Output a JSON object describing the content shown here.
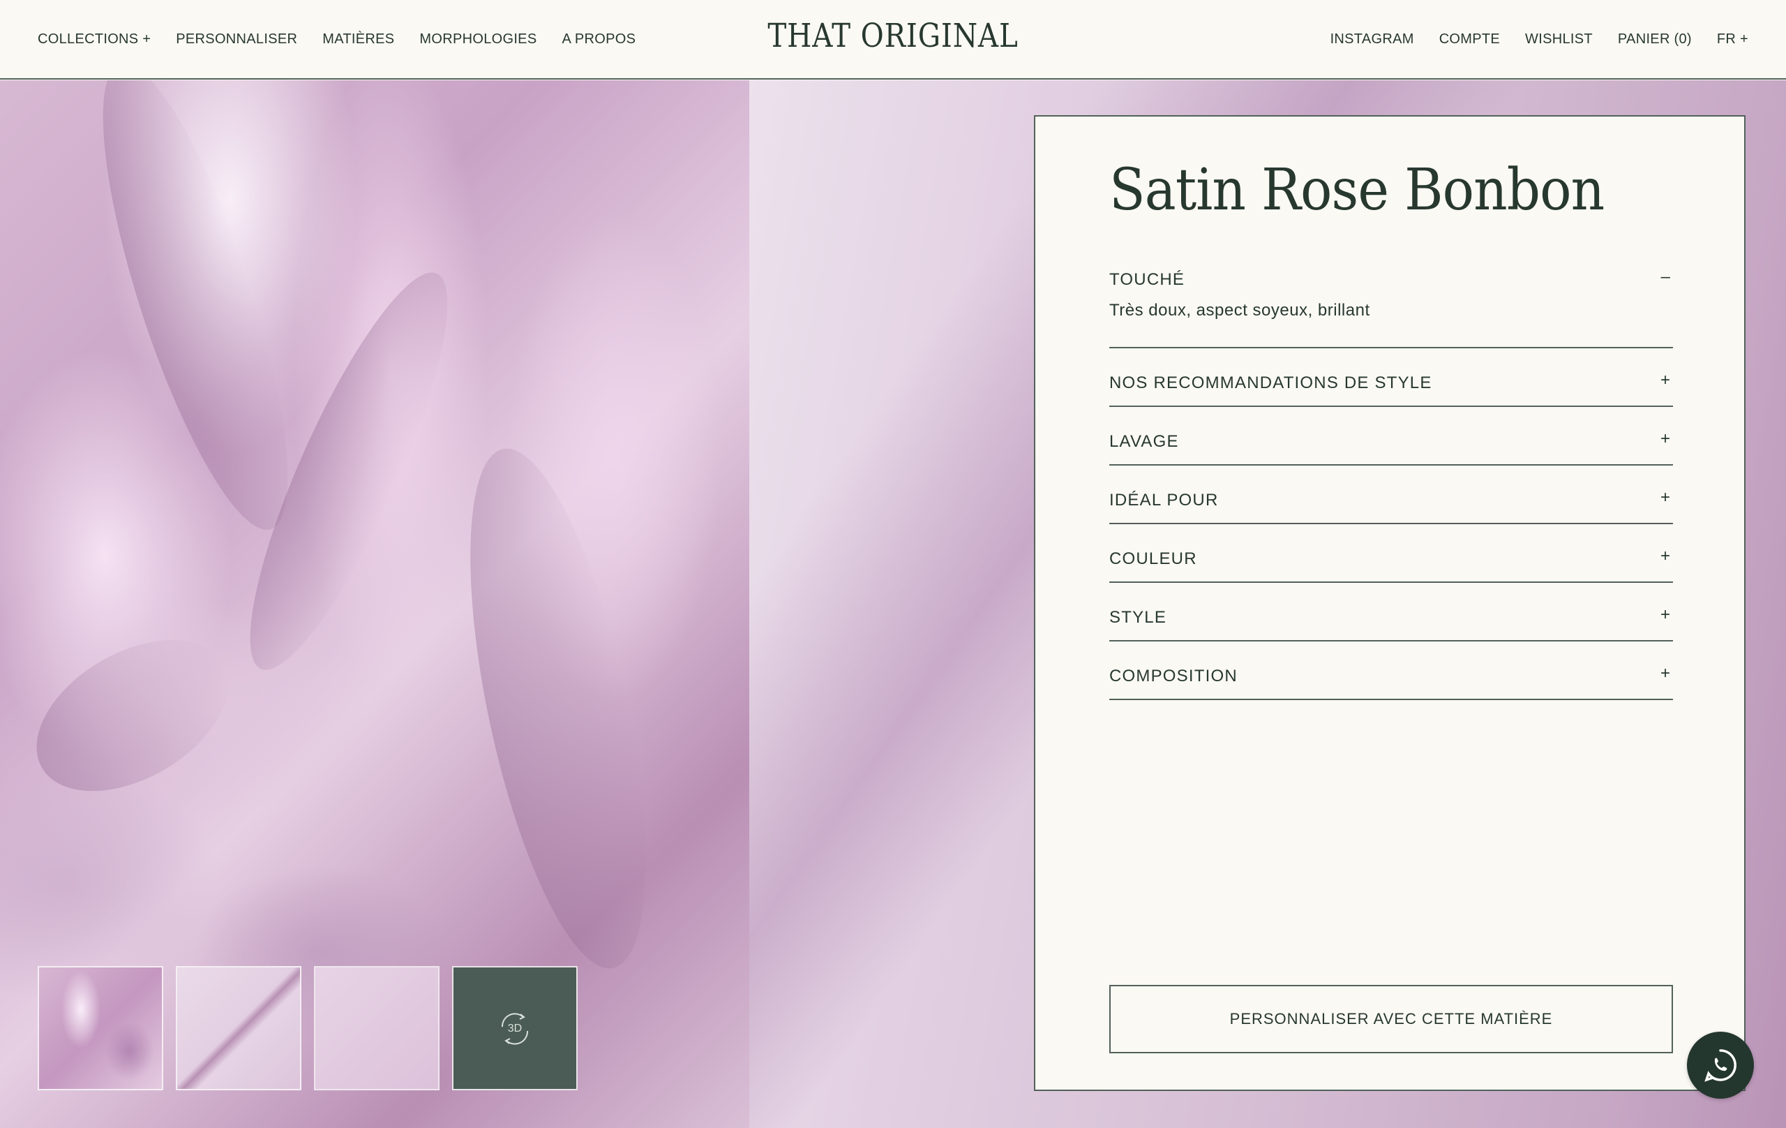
{
  "header": {
    "nav_left": [
      {
        "label": "COLLECTIONS +",
        "name": "nav-collections"
      },
      {
        "label": "PERSONNALISER",
        "name": "nav-personnaliser"
      },
      {
        "label": "MATIÈRES",
        "name": "nav-matieres"
      },
      {
        "label": "MORPHOLOGIES",
        "name": "nav-morphologies"
      },
      {
        "label": "A PROPOS",
        "name": "nav-a-propos"
      }
    ],
    "logo": "THAT ORIGINAL",
    "nav_right": [
      {
        "label": "INSTAGRAM",
        "name": "nav-instagram"
      },
      {
        "label": "COMPTE",
        "name": "nav-compte"
      },
      {
        "label": "WISHLIST",
        "name": "nav-wishlist"
      },
      {
        "label": "PANIER (0)",
        "name": "nav-panier"
      },
      {
        "label": "FR +",
        "name": "nav-language"
      }
    ]
  },
  "gallery": {
    "thumbnails": [
      "fabric-drape",
      "fabric-fold",
      "fabric-flat",
      "3d-view"
    ],
    "three_d_label": "3D"
  },
  "product": {
    "title": "Satin Rose Bonbon",
    "accordion": [
      {
        "label": "TOUCHÉ",
        "open": true,
        "toggle": "–",
        "content": "Très doux, aspect soyeux, brillant"
      },
      {
        "label": "NOS RECOMMANDATIONS DE STYLE",
        "open": false,
        "toggle": "+"
      },
      {
        "label": "LAVAGE",
        "open": false,
        "toggle": "+"
      },
      {
        "label": "IDÉAL POUR",
        "open": false,
        "toggle": "+"
      },
      {
        "label": "COULEUR",
        "open": false,
        "toggle": "+"
      },
      {
        "label": "STYLE",
        "open": false,
        "toggle": "+"
      },
      {
        "label": "COMPOSITION",
        "open": false,
        "toggle": "+"
      }
    ],
    "cta_label": "PERSONNALISER AVEC CETTE MATIÈRE"
  },
  "colors": {
    "accent": "#27382f",
    "panel_bg": "#fbf9f4",
    "fabric": "#d7b9d3",
    "whatsapp_bg": "#24372f"
  },
  "icons": {
    "whatsapp": "whatsapp-icon",
    "three_d": "rotate-3d-icon"
  }
}
